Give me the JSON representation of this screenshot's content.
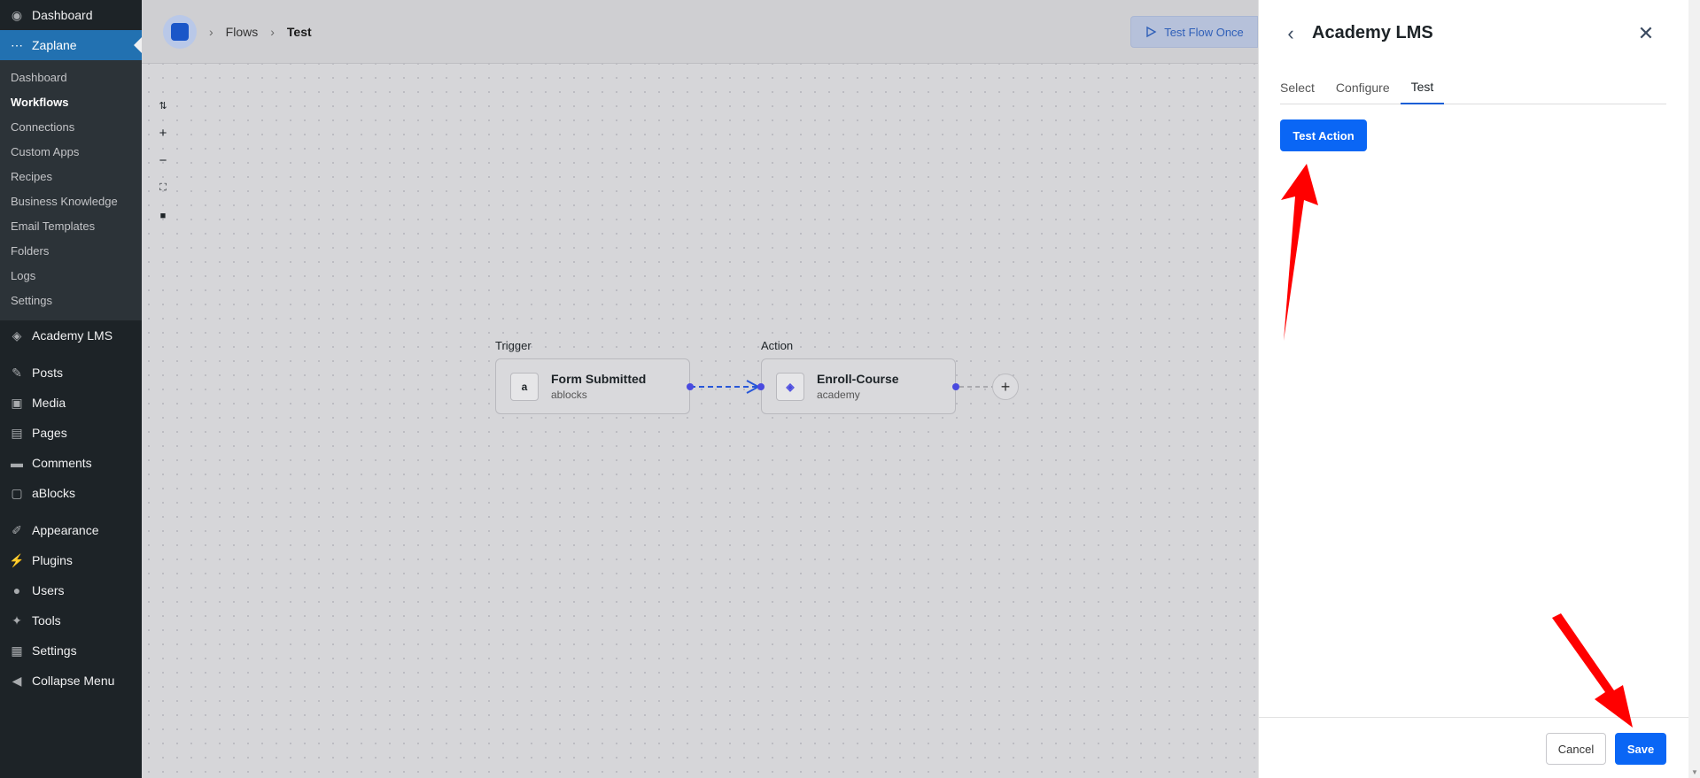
{
  "sidebar": {
    "top_items": [
      {
        "label": "Dashboard",
        "icon": "dashboard-icon"
      },
      {
        "label": "Zaplane",
        "icon": "zaplane-icon"
      }
    ],
    "submenu": [
      "Dashboard",
      "Workflows",
      "Connections",
      "Custom Apps",
      "Recipes",
      "Business Knowledge",
      "Email Templates",
      "Folders",
      "Logs",
      "Settings"
    ],
    "active_submenu": "Workflows",
    "items": [
      {
        "label": "Academy LMS",
        "icon": "academy-icon"
      },
      {
        "label": "Posts",
        "icon": "pin-icon"
      },
      {
        "label": "Media",
        "icon": "media-icon"
      },
      {
        "label": "Pages",
        "icon": "pages-icon"
      },
      {
        "label": "Comments",
        "icon": "comment-icon"
      },
      {
        "label": "aBlocks",
        "icon": "ablocks-icon"
      },
      {
        "label": "Appearance",
        "icon": "brush-icon"
      },
      {
        "label": "Plugins",
        "icon": "plug-icon"
      },
      {
        "label": "Users",
        "icon": "user-icon"
      },
      {
        "label": "Tools",
        "icon": "wrench-icon"
      },
      {
        "label": "Settings",
        "icon": "settings-icon"
      },
      {
        "label": "Collapse Menu",
        "icon": "collapse-icon"
      }
    ]
  },
  "topbar": {
    "breadcrumb": [
      "Flows",
      "Test"
    ],
    "test_flow_label": "Test Flow Once"
  },
  "canvas": {
    "trigger_label": "Trigger",
    "action_label": "Action",
    "trigger_node": {
      "title": "Form Submitted",
      "subtitle": "ablocks"
    },
    "action_node": {
      "title": "Enroll-Course",
      "subtitle": "academy"
    }
  },
  "panel": {
    "title": "Academy LMS",
    "tabs": [
      "Select",
      "Configure",
      "Test"
    ],
    "active_tab": "Test",
    "test_action_label": "Test Action",
    "cancel_label": "Cancel",
    "save_label": "Save"
  },
  "colors": {
    "accent": "#0a66f5",
    "sidebar_bg": "#1d2327",
    "current_menu": "#2271b1",
    "annotation_arrow": "#ff0000"
  }
}
